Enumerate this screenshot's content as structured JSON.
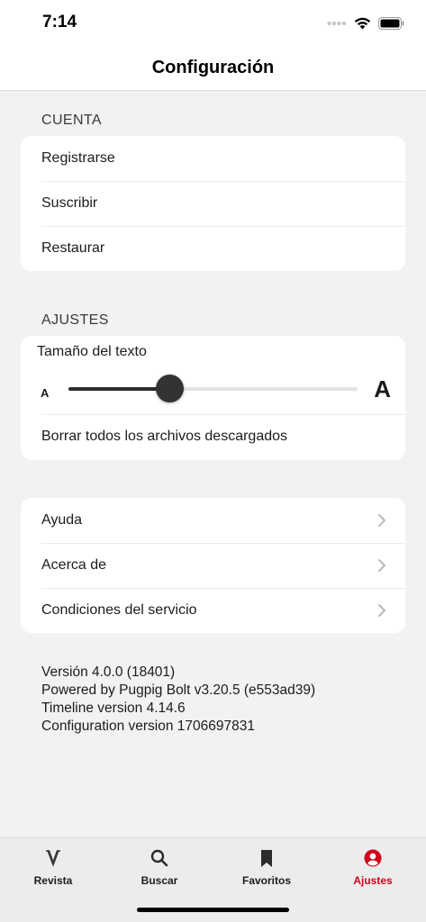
{
  "status_bar": {
    "time": "7:14"
  },
  "nav": {
    "title": "Configuración"
  },
  "cuenta": {
    "header": "CUENTA",
    "items": [
      {
        "label": "Registrarse"
      },
      {
        "label": "Suscribir"
      },
      {
        "label": "Restaurar"
      }
    ]
  },
  "ajustes": {
    "header": "AJUSTES",
    "text_size_label": "Tamaño del texto",
    "small_a": "A",
    "big_a": "A",
    "text_size_value": 0.35,
    "clear_label": "Borrar todos los archivos descargados"
  },
  "info": {
    "items": [
      {
        "label": "Ayuda"
      },
      {
        "label": "Acerca de"
      },
      {
        "label": "Condiciones del servicio"
      }
    ]
  },
  "version": {
    "lines": [
      "Versión 4.0.0 (18401)",
      "Powered by Pugpig Bolt v3.20.5 (e553ad39)",
      "Timeline version 4.14.6",
      "Configuration version 1706697831"
    ]
  },
  "tabs": [
    {
      "label": "Revista",
      "icon": "magazine-v-icon",
      "active": false
    },
    {
      "label": "Buscar",
      "icon": "search-icon",
      "active": false
    },
    {
      "label": "Favoritos",
      "icon": "bookmark-icon",
      "active": false
    },
    {
      "label": "Ajustes",
      "icon": "user-icon",
      "active": true
    }
  ],
  "colors": {
    "accent": "#d0021b",
    "background": "#f2f2f2",
    "card": "#ffffff"
  }
}
